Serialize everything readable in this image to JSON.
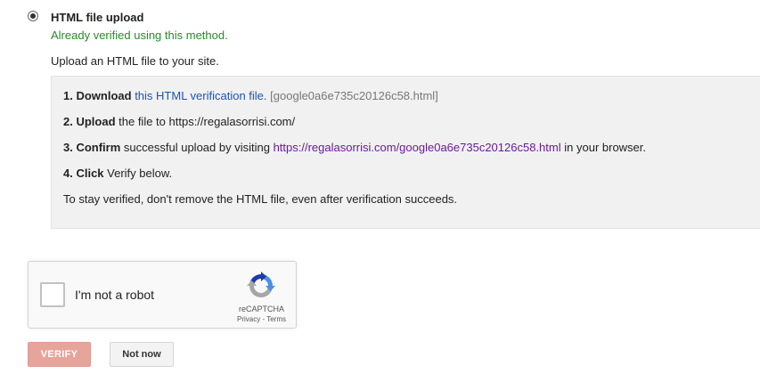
{
  "method": {
    "title": "HTML file upload",
    "verified_note": "Already verified using this method.",
    "description": "Upload an HTML file to your site.",
    "selected": true
  },
  "steps": {
    "s1": {
      "label": "1. Download",
      "link": "this HTML verification file.",
      "filename": "[google0a6e735c20126c58.html]"
    },
    "s2": {
      "label": "2. Upload",
      "text": "the file to https://regalasorrisi.com/"
    },
    "s3": {
      "label": "3. Confirm",
      "text": "successful upload by visiting",
      "link": "https://regalasorrisi.com/google0a6e735c20126c58.html",
      "suffix": "in your browser."
    },
    "s4": {
      "label": "4. Click",
      "text": "Verify below."
    },
    "note": "To stay verified, don't remove the HTML file, even after verification succeeds."
  },
  "recaptcha": {
    "label": "I'm not a robot",
    "brand": "reCAPTCHA",
    "privacy": "Privacy",
    "separator": " - ",
    "terms": "Terms",
    "checked": false
  },
  "actions": {
    "verify_label": "VERIFY",
    "not_now_label": "Not now"
  },
  "colors": {
    "verified_green": "#2a8a2a",
    "link_blue": "#1a55b0",
    "link_purple": "#6a1b9a",
    "verify_button": "#e6a49b"
  }
}
